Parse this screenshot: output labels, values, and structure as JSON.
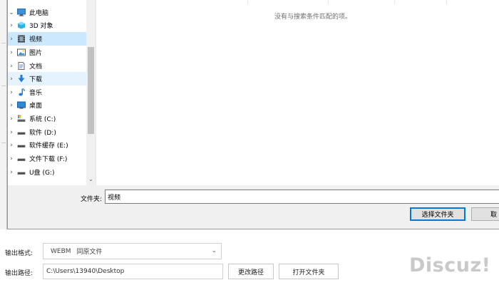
{
  "nav": {
    "root": {
      "label": "此电脑",
      "icon": "monitor-icon"
    },
    "items": [
      {
        "label": "3D 对象",
        "icon": "cube-icon"
      },
      {
        "label": "视频",
        "icon": "film-icon"
      },
      {
        "label": "图片",
        "icon": "image-icon"
      },
      {
        "label": "文档",
        "icon": "document-icon"
      },
      {
        "label": "下载",
        "icon": "download-arrow-icon"
      },
      {
        "label": "音乐",
        "icon": "music-note-icon"
      },
      {
        "label": "桌面",
        "icon": "desktop-icon"
      },
      {
        "label": "系统 (C:)",
        "icon": "system-drive-icon"
      },
      {
        "label": "软件 (D:)",
        "icon": "drive-icon"
      },
      {
        "label": "软件缓存 (E:)",
        "icon": "drive-icon"
      },
      {
        "label": "文件下载 (F:)",
        "icon": "drive-icon"
      },
      {
        "label": "U盘 (G:)",
        "icon": "drive-icon"
      }
    ],
    "selected": "视频"
  },
  "content": {
    "empty_message": "没有与搜索条件匹配的项。"
  },
  "folder": {
    "label": "文件夹:",
    "value": "视频",
    "select_button": "选择文件夹",
    "cancel_button": "取"
  },
  "output": {
    "format_label": "输出格式:",
    "format_value": "WEBM",
    "format_desc": "同原文件",
    "path_label": "输出路径:",
    "path_value": "C:\\Users\\13940\\Desktop",
    "change_path_button": "更改路径",
    "open_folder_button": "打开文件夹"
  },
  "watermark": "Discuz!",
  "colors": {
    "selected_bg": "#cce8ff",
    "accent_border": "#0078d7",
    "download_blue": "#1e7be0"
  }
}
